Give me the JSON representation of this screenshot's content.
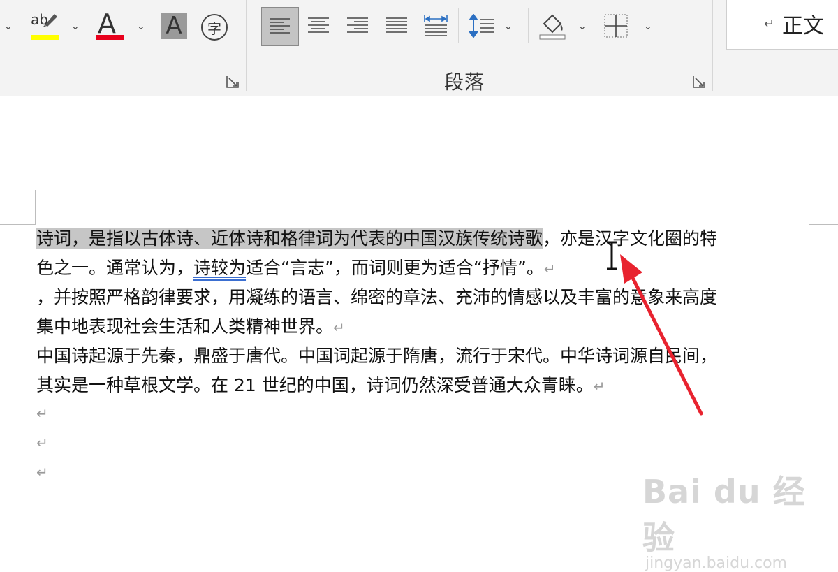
{
  "ribbon": {
    "font_group": {
      "highlight_letters": "ab",
      "font_color_letter": "A",
      "shading_letter": "A",
      "enclose_char": "字",
      "highlight_color": "#ffff00",
      "font_color": "#e8001c"
    },
    "paragraph_group": {
      "label": "段落"
    },
    "styles": {
      "current": "正文"
    }
  },
  "document": {
    "lines": [
      {
        "selected": "诗词，是指以古体诗、近体诗和格律词为代表的中国汉族传统诗歌",
        "rest": "，亦是汉字文化圈的特"
      },
      {
        "before": "色之一。通常认为，",
        "underlined": "诗较为",
        "after": "适合“言志”，而词则更为适合“抒情”。"
      },
      {
        "text": "，并按照严格韵律要求，用凝练的语言、绵密的章法、充沛的情感以及丰富的意象来高度"
      },
      {
        "text": "集中地表现社会生活和人类精神世界。"
      },
      {
        "text": "中国诗起源于先秦，鼎盛于唐代。中国词起源于隋唐，流行于宋代。中华诗词源自民间，"
      },
      {
        "text": "其实是一种草根文学。在 21 世纪的中国，诗词仍然深受普通大众青睐。"
      }
    ],
    "paragraph_mark": "↵"
  },
  "annotation": {
    "arrow_color": "#e8232f"
  },
  "watermark": {
    "main": "Bai du 经验",
    "sub": "jingyan.baidu.com"
  }
}
